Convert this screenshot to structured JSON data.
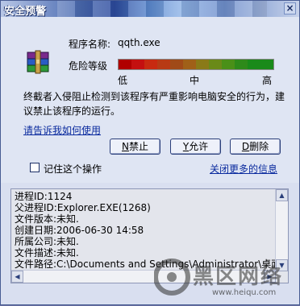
{
  "window": {
    "title": "安全预警"
  },
  "info": {
    "program_name_label": "程序名称:",
    "program_name_value": "qqth.exe",
    "risk_label": "危险等级",
    "levels": {
      "low": "低",
      "mid": "中",
      "high": "高"
    }
  },
  "message": "终截者入侵阻止检测到该程序有严重影响电脑安全的行为，建议禁止该程序的运行。",
  "links": {
    "tell_me": "请告诉我如何使用",
    "close_more": "关闭更多的信息"
  },
  "buttons": {
    "block": {
      "key": "N",
      "label": "禁止"
    },
    "allow": {
      "key": "Y",
      "label": "允许"
    },
    "delete": {
      "key": "D",
      "label": "删除"
    }
  },
  "remember_label": "记住这个操作",
  "details": [
    "进程ID:1124",
    "父进程ID:Explorer.EXE(1268)",
    "文件版本:未知.",
    "创建日期:2006-06-30 14:58",
    "所属公司:未知.",
    "文件描述:未知.",
    "文件路径:C:\\Documents and Settings\\Administrator\\桌面\\"
  ],
  "watermark": {
    "text": "黑区网络",
    "url": "www.heiqu.com"
  },
  "colors": {
    "risk_low": "#b00000",
    "risk_high": "#1a8a1a"
  }
}
